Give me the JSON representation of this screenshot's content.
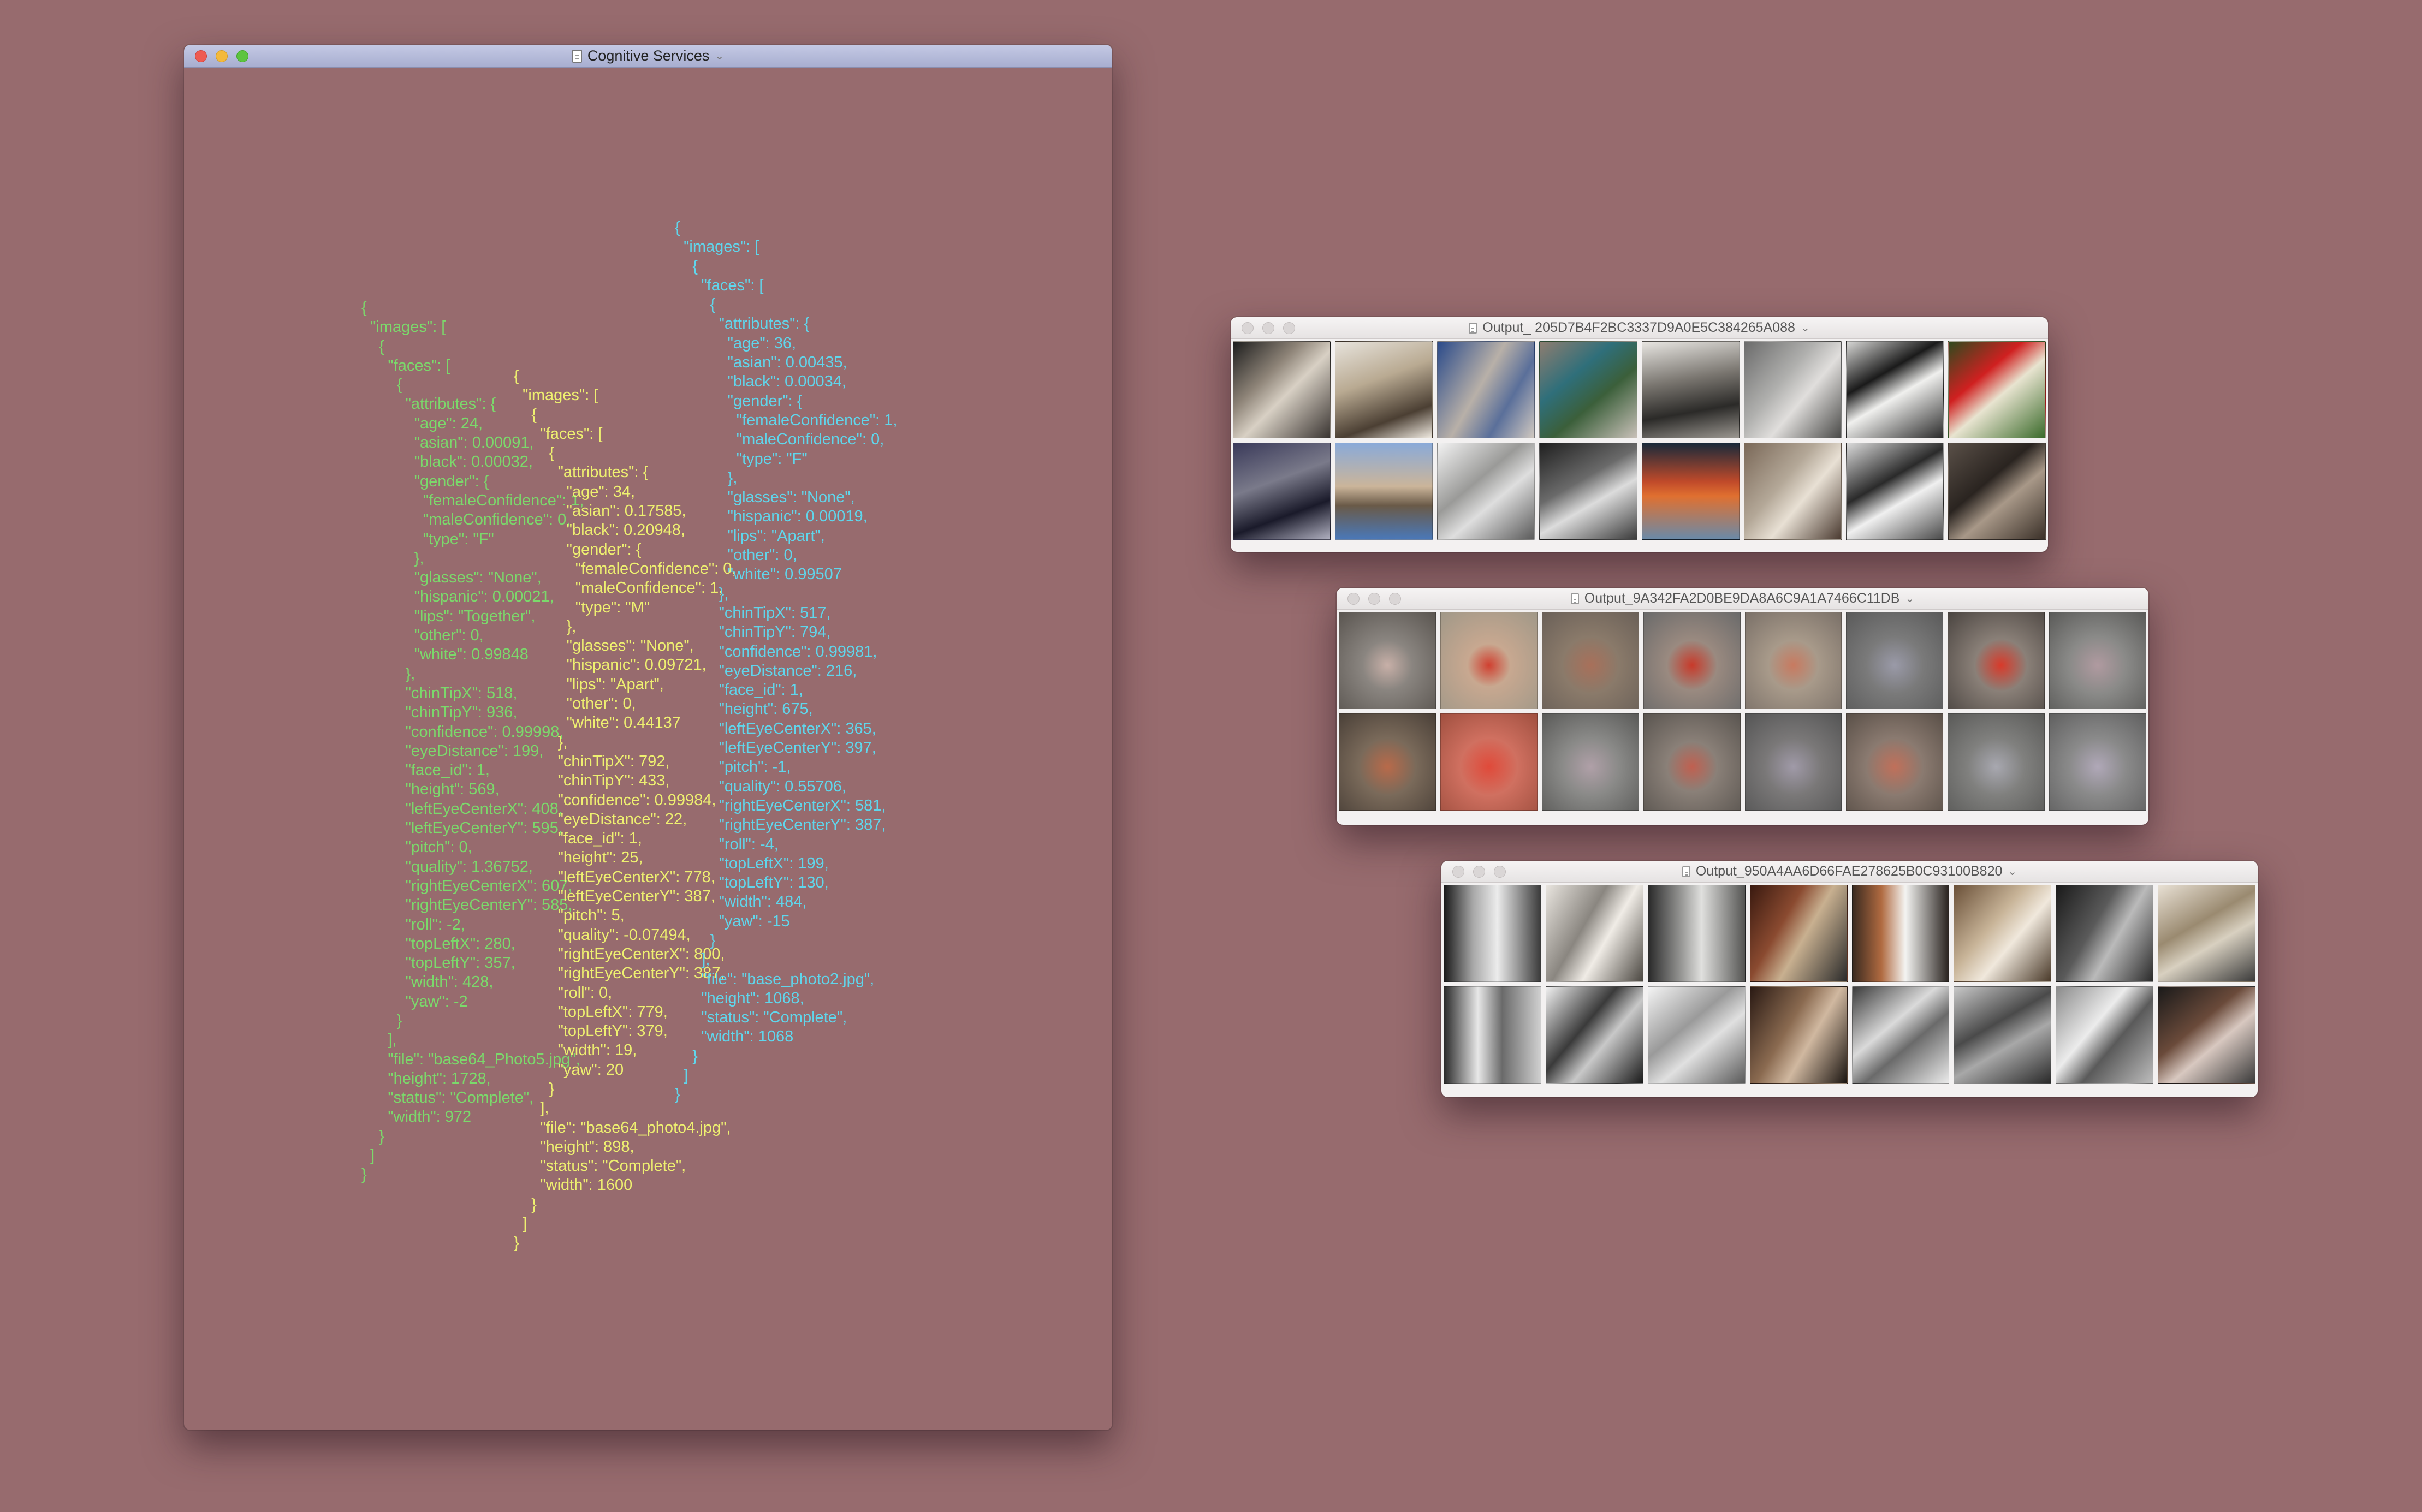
{
  "main_window": {
    "title": "Cognitive Services",
    "json_blocks": {
      "green": "{\n  \"images\": [\n    {\n      \"faces\": [\n        {\n          \"attributes\": {\n            \"age\": 24,\n            \"asian\": 0.00091,\n            \"black\": 0.00032,\n            \"gender\": {\n              \"femaleConfidence\": 1,\n              \"maleConfidence\": 0,\n              \"type\": \"F\"\n            },\n            \"glasses\": \"None\",\n            \"hispanic\": 0.00021,\n            \"lips\": \"Together\",\n            \"other\": 0,\n            \"white\": 0.99848\n          },\n          \"chinTipX\": 518,\n          \"chinTipY\": 936,\n          \"confidence\": 0.99998,\n          \"eyeDistance\": 199,\n          \"face_id\": 1,\n          \"height\": 569,\n          \"leftEyeCenterX\": 408,\n          \"leftEyeCenterY\": 595,\n          \"pitch\": 0,\n          \"quality\": 1.36752,\n          \"rightEyeCenterX\": 607,\n          \"rightEyeCenterY\": 585,\n          \"roll\": -2,\n          \"topLeftX\": 280,\n          \"topLeftY\": 357,\n          \"width\": 428,\n          \"yaw\": -2\n        }\n      ],\n      \"file\": \"base64_Photo5.jpg\",\n      \"height\": 1728,\n      \"status\": \"Complete\",\n      \"width\": 972\n    }\n  ]\n}",
      "yellow": "{\n  \"images\": [\n    {\n      \"faces\": [\n        {\n          \"attributes\": {\n            \"age\": 34,\n            \"asian\": 0.17585,\n            \"black\": 0.20948,\n            \"gender\": {\n              \"femaleConfidence\": 0,\n              \"maleConfidence\": 1,\n              \"type\": \"M\"\n            },\n            \"glasses\": \"None\",\n            \"hispanic\": 0.09721,\n            \"lips\": \"Apart\",\n            \"other\": 0,\n            \"white\": 0.44137\n          },\n          \"chinTipX\": 792,\n          \"chinTipY\": 433,\n          \"confidence\": 0.99984,\n          \"eyeDistance\": 22,\n          \"face_id\": 1,\n          \"height\": 25,\n          \"leftEyeCenterX\": 778,\n          \"leftEyeCenterY\": 387,\n          \"pitch\": 5,\n          \"quality\": -0.07494,\n          \"rightEyeCenterX\": 800,\n          \"rightEyeCenterY\": 387,\n          \"roll\": 0,\n          \"topLeftX\": 779,\n          \"topLeftY\": 379,\n          \"width\": 19,\n          \"yaw\": 20\n        }\n      ],\n      \"file\": \"base64_photo4.jpg\",\n      \"height\": 898,\n      \"status\": \"Complete\",\n      \"width\": 1600\n    }\n  ]\n}",
      "cyan": "{\n  \"images\": [\n    {\n      \"faces\": [\n        {\n          \"attributes\": {\n            \"age\": 36,\n            \"asian\": 0.00435,\n            \"black\": 0.00034,\n            \"gender\": {\n              \"femaleConfidence\": 1,\n              \"maleConfidence\": 0,\n              \"type\": \"F\"\n            },\n            \"glasses\": \"None\",\n            \"hispanic\": 0.00019,\n            \"lips\": \"Apart\",\n            \"other\": 0,\n            \"white\": 0.99507\n          },\n          \"chinTipX\": 517,\n          \"chinTipY\": 794,\n          \"confidence\": 0.99981,\n          \"eyeDistance\": 216,\n          \"face_id\": 1,\n          \"height\": 675,\n          \"leftEyeCenterX\": 365,\n          \"leftEyeCenterY\": 397,\n          \"pitch\": -1,\n          \"quality\": 0.55706,\n          \"rightEyeCenterX\": 581,\n          \"rightEyeCenterY\": 387,\n          \"roll\": -4,\n          \"topLeftX\": 199,\n          \"topLeftY\": 130,\n          \"width\": 484,\n          \"yaw\": -15\n        }\n      ],\n      \"file\": \"base_photo2.jpg\",\n      \"height\": 1068,\n      \"status\": \"Complete\",\n      \"width\": 1068\n    }\n  ]\n}"
    }
  },
  "output_windows": [
    {
      "title": "Output_ 205D7B4F2BC3337D9A0E5C384265A088",
      "icon": "document-icon",
      "thumbnails": [
        "linear-gradient(135deg,#1d1d1d 0%,#8e8478 35%,#d8d0c4 55%,#3a3532 100%)",
        "linear-gradient(160deg,#e7e3dc 0%,#b9aa92 40%,#4b3f33 75%,#efe9e0 100%)",
        "linear-gradient(120deg,#2a4a8a 0%,#b8b0a8 45%,#5a6f9a 70%,#d0c8c0 100%)",
        "linear-gradient(140deg,#8e7d70 0%,#2f6f7a 35%,#3b5f3a 60%,#c8c0b8 100%)",
        "linear-gradient(170deg,#e8e6e2 0%,#7a7670 40%,#2b2a28 70%,#9a9690 100%)",
        "linear-gradient(130deg,#6b6b6b 0%,#b0b0ae 40%,#e0dedc 60%,#4a4a48 100%)",
        "linear-gradient(150deg,#d8d8d6 0%,#1a1a1a 35%,#f0f0ee 55%,#2a2a2a 100%)",
        "linear-gradient(140deg,#2e4a1e 0%,#d02020 35%,#e8e4d0 55%,#3a6a2a 100%)",
        "linear-gradient(160deg,#3a3a5a 0%,#7a7a8a 40%,#1a1a2a 70%,#b0b0c0 100%)",
        "linear-gradient(180deg,#8aaad8 0%,#cbb59a 45%,#6a5a48 65%,#4a78b8 100%)",
        "linear-gradient(140deg,#f2f2f2 0%,#9a9a98 40%,#dedede 60%,#5a5a5a 100%)",
        "linear-gradient(150deg,#202020 0%,#6a6a6a 40%,#dcdcdc 60%,#3a3a3a 100%)",
        "linear-gradient(180deg,#1a2a3a 0%,#c04a2a 40%,#e07030 55%,#6a8aa8 100%)",
        "linear-gradient(130deg,#7a6858 0%,#b4a898 40%,#e8e0d4 60%,#4a3a30 100%)",
        "linear-gradient(150deg,#dadada 0%,#2a2a2a 40%,#f0f0f0 60%,#4a4a4a 100%)",
        "linear-gradient(140deg,#5a5048 0%,#2a2420 40%,#a89888 60%,#3a3028 100%)"
      ]
    },
    {
      "title": "Output_9A342FA2D0BE9DA8A6C9A1A7466C11DB",
      "icon": "document-icon",
      "thumbnails": [
        "radial-gradient(circle at 50% 55%,#c8b0a8 0%,#8a8580 35%,#5a5550 100%)",
        "radial-gradient(circle at 50% 55%,#d04030 0%,#c8a890 30%,#a09888 100%)",
        "radial-gradient(circle at 50% 55%,#a8705a 0%,#8a7a6a 40%,#6a6058 100%)",
        "radial-gradient(circle at 50% 55%,#c83a2a 0%,#9a8a80 35%,#6a6a6a 100%)",
        "radial-gradient(circle at 50% 55%,#c87a60 0%,#a89a8a 35%,#7a7068 100%)",
        "radial-gradient(circle at 50% 55%,#9a9aa8 0%,#7a7a7a 40%,#5a5a5a 100%)",
        "radial-gradient(circle at 55% 55%,#d83a2a 0%,#8a8078 35%,#4a4440 100%)",
        "radial-gradient(circle at 50% 55%,#b09aa0 0%,#8a8a88 40%,#5a5a58 100%)",
        "radial-gradient(circle at 50% 55%,#b86a4a 0%,#7a6a5a 40%,#4a4038 100%)",
        "radial-gradient(circle at 50% 55%,#e04a3a 0%,#d07060 40%,#a05040 100%)",
        "radial-gradient(circle at 50% 55%,#b0a0a8 0%,#8a8a88 40%,#5a5a58 100%)",
        "radial-gradient(circle at 50% 55%,#c06050 0%,#8a8078 35%,#5a5550 100%)",
        "radial-gradient(circle at 50% 55%,#a09aa8 0%,#7a7878 40%,#555555 100%)",
        "radial-gradient(circle at 50% 55%,#c0705a 0%,#8a7a70 40%,#5a5048 100%)",
        "radial-gradient(circle at 50% 55%,#a8a8b0 0%,#80807e 40%,#5a5a58 100%)",
        "radial-gradient(circle at 50% 55%,#b0a8b8 0%,#8a8a8a 40%,#606060 100%)"
      ]
    },
    {
      "title": "Output_950A4AA6D66FAE278625B0C93100B820",
      "icon": "document-icon",
      "thumbnails": [
        "linear-gradient(90deg,#1a1a1a 0%,#a8a8a8 30%,#ececec 55%,#3a3a3a 100%)",
        "linear-gradient(120deg,#e8e4de 0%,#8a8680 40%,#f0ece6 60%,#4a4640 100%)",
        "linear-gradient(90deg,#2a2a2a 0%,#9a9a98 35%,#e0e0de 55%,#555553 100%)",
        "linear-gradient(120deg,#3a1a10 0%,#8a4a30 35%,#c8b090 55%,#2a2a2a 100%)",
        "linear-gradient(90deg,#3a2a20 0%,#b06a40 30%,#f4f4f2 55%,#2a2420 100%)",
        "linear-gradient(130deg,#6a5038 0%,#c8b498 40%,#f0e8dc 60%,#4a3a2a 100%)",
        "linear-gradient(120deg,#1a1a1a 0%,#5a5a5a 40%,#bababa 60%,#2a2a2a 100%)",
        "linear-gradient(150deg,#e8e0d4 0%,#9a8a70 40%,#d8d0c0 60%,#3a3a3a 100%)",
        "linear-gradient(90deg,#2a2a2a 0%,#e8e8e8 35%,#6a6a6a 60%,#d0d0d0 100%)",
        "linear-gradient(130deg,#f0f0f0 0%,#3a3a3a 40%,#c8c8c8 60%,#1a1a1a 100%)",
        "linear-gradient(140deg,#f4f4f4 0%,#9a9a9a 40%,#e0e0e0 60%,#5a5a5a 100%)",
        "linear-gradient(120deg,#2a1a14 0%,#8a6a50 40%,#d0b8a0 60%,#1a1410 100%)",
        "linear-gradient(140deg,#3a3a3a 0%,#dadada 40%,#6a6a6a 60%,#eaeaea 100%)",
        "linear-gradient(150deg,#c8c8c8 0%,#4a4a4a 40%,#a8a8a8 60%,#2a2a2a 100%)",
        "linear-gradient(130deg,#8a8a8a 0%,#ececec 40%,#5a5a5a 60%,#bcbcbc 100%)",
        "linear-gradient(140deg,#1a1a1a 0%,#6a4a3a 40%,#d8c8c0 60%,#3a3a3a 100%)"
      ]
    }
  ]
}
